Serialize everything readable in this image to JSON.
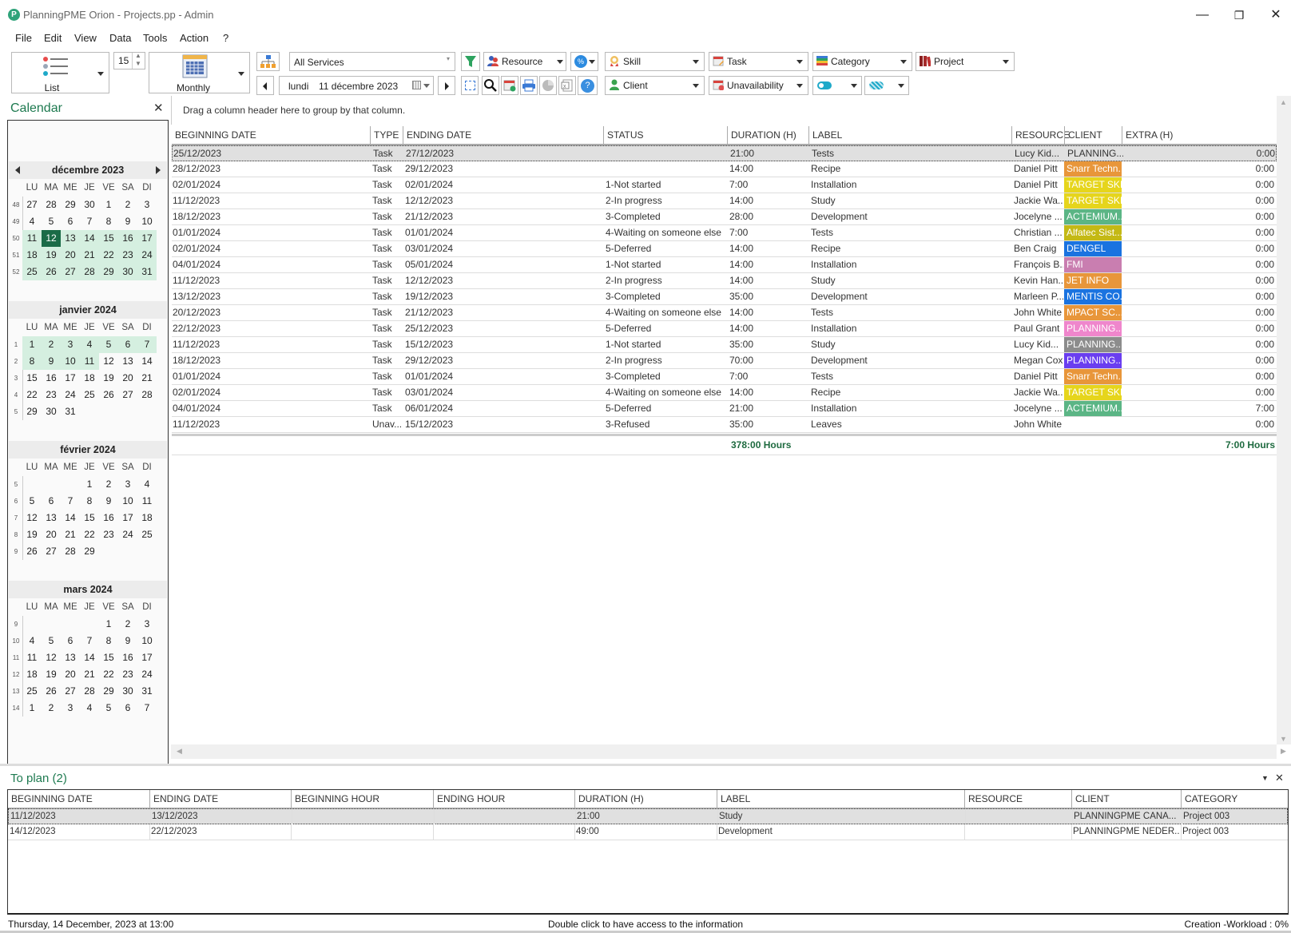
{
  "window": {
    "title": "PlanningPME Orion - Projects.pp - Admin",
    "controls": {
      "minimize": "—",
      "restore": "❐",
      "close": "✕"
    }
  },
  "menu": [
    "File",
    "Edit",
    "View",
    "Data",
    "Tools",
    "Action",
    "?"
  ],
  "toolbar": {
    "view_mode": {
      "label": "List",
      "icon": "list-icon"
    },
    "spin_value": "15",
    "period": {
      "label": "Monthly",
      "icon": "calendar-grid-icon"
    },
    "services": {
      "value": "All Services"
    },
    "date": {
      "day": "lundi",
      "value": "11 décembre 2023"
    },
    "resource": "Resource",
    "skill": "Skill",
    "task": "Task",
    "category": "Category",
    "project": "Project",
    "client": "Client",
    "unavailability": "Unavailability"
  },
  "calendar": {
    "title": "Calendar",
    "day_headers": [
      "LU",
      "MA",
      "ME",
      "JE",
      "VE",
      "SA",
      "DI"
    ],
    "months": [
      {
        "name": "décembre 2023",
        "nav": true,
        "weeks": [
          {
            "wk": "48",
            "days": [
              "27",
              "28",
              "29",
              "30",
              "1",
              "2",
              "3"
            ]
          },
          {
            "wk": "49",
            "days": [
              "4",
              "5",
              "6",
              "7",
              "8",
              "9",
              "10"
            ]
          },
          {
            "wk": "50",
            "days": [
              "11",
              "12",
              "13",
              "14",
              "15",
              "16",
              "17"
            ]
          },
          {
            "wk": "51",
            "days": [
              "18",
              "19",
              "20",
              "21",
              "22",
              "23",
              "24"
            ]
          },
          {
            "wk": "52",
            "days": [
              "25",
              "26",
              "27",
              "28",
              "29",
              "30",
              "31"
            ]
          }
        ]
      },
      {
        "name": "janvier 2024",
        "weeks": [
          {
            "wk": "1",
            "days": [
              "1",
              "2",
              "3",
              "4",
              "5",
              "6",
              "7"
            ]
          },
          {
            "wk": "2",
            "days": [
              "8",
              "9",
              "10",
              "11",
              "12",
              "13",
              "14"
            ]
          },
          {
            "wk": "3",
            "days": [
              "15",
              "16",
              "17",
              "18",
              "19",
              "20",
              "21"
            ]
          },
          {
            "wk": "4",
            "days": [
              "22",
              "23",
              "24",
              "25",
              "26",
              "27",
              "28"
            ]
          },
          {
            "wk": "5",
            "days": [
              "29",
              "30",
              "31",
              "",
              "",
              "",
              ""
            ]
          }
        ]
      },
      {
        "name": "février 2024",
        "weeks": [
          {
            "wk": "5",
            "days": [
              "",
              "",
              "",
              "1",
              "2",
              "3",
              "4"
            ]
          },
          {
            "wk": "6",
            "days": [
              "5",
              "6",
              "7",
              "8",
              "9",
              "10",
              "11"
            ]
          },
          {
            "wk": "7",
            "days": [
              "12",
              "13",
              "14",
              "15",
              "16",
              "17",
              "18"
            ]
          },
          {
            "wk": "8",
            "days": [
              "19",
              "20",
              "21",
              "22",
              "23",
              "24",
              "25"
            ]
          },
          {
            "wk": "9",
            "days": [
              "26",
              "27",
              "28",
              "29",
              "",
              "",
              ""
            ]
          }
        ]
      },
      {
        "name": "mars 2024",
        "weeks": [
          {
            "wk": "9",
            "days": [
              "",
              "",
              "",
              "",
              "1",
              "2",
              "3"
            ]
          },
          {
            "wk": "10",
            "days": [
              "4",
              "5",
              "6",
              "7",
              "8",
              "9",
              "10"
            ]
          },
          {
            "wk": "11",
            "days": [
              "11",
              "12",
              "13",
              "14",
              "15",
              "16",
              "17"
            ]
          },
          {
            "wk": "12",
            "days": [
              "18",
              "19",
              "20",
              "21",
              "22",
              "23",
              "24"
            ]
          },
          {
            "wk": "13",
            "days": [
              "25",
              "26",
              "27",
              "28",
              "29",
              "30",
              "31"
            ]
          },
          {
            "wk": "14",
            "days": [
              "1",
              "2",
              "3",
              "4",
              "5",
              "6",
              "7"
            ]
          }
        ]
      }
    ],
    "today": "12 décembre 2023",
    "highlight_range": "11/12/2023 - 11/01/2024"
  },
  "grid": {
    "group_hint": "Drag a column header here to group by that column.",
    "columns": [
      "BEGINNING DATE",
      "TYPE",
      "ENDING DATE",
      "STATUS",
      "DURATION (H)",
      "LABEL",
      "RESOURCE",
      "CLIENT",
      "EXTRA (H)"
    ],
    "rows": [
      {
        "begin": "25/12/2023",
        "type": "Task",
        "end": "27/12/2023",
        "status": "",
        "duration": "21:00",
        "label": "Tests",
        "resource": "Lucy Kid...",
        "client": "PLANNING...",
        "client_color": "",
        "extra": "0:00",
        "selected": true
      },
      {
        "begin": "28/12/2023",
        "type": "Task",
        "end": "29/12/2023",
        "status": "",
        "duration": "14:00",
        "label": "Recipe",
        "resource": "Daniel Pitt",
        "client": "Snarr Techn...",
        "client_color": "#e8963a",
        "extra": "0:00"
      },
      {
        "begin": "02/01/2024",
        "type": "Task",
        "end": "02/01/2024",
        "status": "1-Not started",
        "duration": "7:00",
        "label": "Installation",
        "resource": "Daniel Pitt",
        "client": "TARGET SKI...",
        "client_color": "#e6d51c",
        "extra": "0:00"
      },
      {
        "begin": "11/12/2023",
        "type": "Task",
        "end": "12/12/2023",
        "status": "2-In progress",
        "duration": "14:00",
        "label": "Study",
        "resource": "Jackie Wa...",
        "client": "TARGET SKI...",
        "client_color": "#e6d51c",
        "extra": "0:00"
      },
      {
        "begin": "18/12/2023",
        "type": "Task",
        "end": "21/12/2023",
        "status": "3-Completed",
        "duration": "28:00",
        "label": "Development",
        "resource": "Jocelyne ...",
        "client": "ACTEMIUM...",
        "client_color": "#5bb585",
        "extra": "0:00"
      },
      {
        "begin": "01/01/2024",
        "type": "Task",
        "end": "01/01/2024",
        "status": "4-Waiting on someone else",
        "duration": "7:00",
        "label": "Tests",
        "resource": "Christian ...",
        "client": "Alfatec Sist...",
        "client_color": "#c4b915",
        "extra": "0:00"
      },
      {
        "begin": "02/01/2024",
        "type": "Task",
        "end": "03/01/2024",
        "status": "5-Deferred",
        "duration": "14:00",
        "label": "Recipe",
        "resource": "Ben Craig",
        "client": "DENGEL",
        "client_color": "#1a73e0",
        "extra": "0:00"
      },
      {
        "begin": "04/01/2024",
        "type": "Task",
        "end": "05/01/2024",
        "status": "1-Not started",
        "duration": "14:00",
        "label": "Installation",
        "resource": "François B...",
        "client": "FMI",
        "client_color": "#c97eb0",
        "extra": "0:00"
      },
      {
        "begin": "11/12/2023",
        "type": "Task",
        "end": "12/12/2023",
        "status": "2-In progress",
        "duration": "14:00",
        "label": "Study",
        "resource": "Kevin Han...",
        "client": "JET INFO",
        "client_color": "#e8963a",
        "extra": "0:00"
      },
      {
        "begin": "13/12/2023",
        "type": "Task",
        "end": "19/12/2023",
        "status": "3-Completed",
        "duration": "35:00",
        "label": "Development",
        "resource": "Marleen P...",
        "client": "MENTIS CO...",
        "client_color": "#1a73e0",
        "extra": "0:00"
      },
      {
        "begin": "20/12/2023",
        "type": "Task",
        "end": "21/12/2023",
        "status": "4-Waiting on someone else",
        "duration": "14:00",
        "label": "Tests",
        "resource": "John White",
        "client": "MPACT SC...",
        "client_color": "#e8963a",
        "extra": "0:00"
      },
      {
        "begin": "22/12/2023",
        "type": "Task",
        "end": "25/12/2023",
        "status": "5-Deferred",
        "duration": "14:00",
        "label": "Installation",
        "resource": "Paul Grant",
        "client": "PLANNING...",
        "client_color": "#ef86cc",
        "extra": "0:00"
      },
      {
        "begin": "11/12/2023",
        "type": "Task",
        "end": "15/12/2023",
        "status": "1-Not started",
        "duration": "35:00",
        "label": "Study",
        "resource": "Lucy Kid...",
        "client": "PLANNING...",
        "client_color": "#8c8c8c",
        "extra": "0:00"
      },
      {
        "begin": "18/12/2023",
        "type": "Task",
        "end": "29/12/2023",
        "status": "2-In progress",
        "duration": "70:00",
        "label": "Development",
        "resource": "Megan Cox",
        "client": "PLANNING...",
        "client_color": "#6a3ef0",
        "extra": "0:00"
      },
      {
        "begin": "01/01/2024",
        "type": "Task",
        "end": "01/01/2024",
        "status": "3-Completed",
        "duration": "7:00",
        "label": "Tests",
        "resource": "Daniel Pitt",
        "client": "Snarr Techn...",
        "client_color": "#e8963a",
        "extra": "0:00"
      },
      {
        "begin": "02/01/2024",
        "type": "Task",
        "end": "03/01/2024",
        "status": "4-Waiting on someone else",
        "duration": "14:00",
        "label": "Recipe",
        "resource": "Jackie Wa...",
        "client": "TARGET SKI...",
        "client_color": "#e6d51c",
        "extra": "0:00"
      },
      {
        "begin": "04/01/2024",
        "type": "Task",
        "end": "06/01/2024",
        "status": "5-Deferred",
        "duration": "21:00",
        "label": "Installation",
        "resource": "Jocelyne ...",
        "client": "ACTEMIUM...",
        "client_color": "#5bb585",
        "extra": "7:00"
      },
      {
        "begin": "11/12/2023",
        "type": "Unav...",
        "end": "15/12/2023",
        "status": "3-Refused",
        "duration": "35:00",
        "label": "Leaves",
        "resource": "John White",
        "client": "",
        "client_color": "",
        "extra": "0:00"
      }
    ],
    "totals": {
      "duration": "378:00 Hours",
      "extra": "7:00 Hours"
    }
  },
  "to_plan": {
    "title": "To plan (2)",
    "columns": [
      "BEGINNING DATE",
      "ENDING DATE",
      "BEGINNING HOUR",
      "ENDING HOUR",
      "DURATION (H)",
      "LABEL",
      "RESOURCE",
      "CLIENT",
      "CATEGORY"
    ],
    "rows": [
      {
        "begin": "11/12/2023",
        "end": "13/12/2023",
        "begin_hour": "",
        "end_hour": "",
        "duration": "21:00",
        "label": "Study",
        "resource": "",
        "client": "PLANNINGPME CANA...",
        "category": "Project 003",
        "selected": true
      },
      {
        "begin": "14/12/2023",
        "end": "22/12/2023",
        "begin_hour": "",
        "end_hour": "",
        "duration": "49:00",
        "label": "Development",
        "resource": "",
        "client": "PLANNINGPME NEDER...",
        "category": "Project 003"
      }
    ]
  },
  "status_bar": {
    "left": "Thursday, 14 December, 2023 at 13:00",
    "center": "Double click to have access to the information",
    "right": "Creation -Workload : 0%"
  },
  "colors": {
    "accent": "#1e7a50",
    "today": "#1a6b47",
    "range": "#d5efe0",
    "totals": "#1e6a3f"
  }
}
